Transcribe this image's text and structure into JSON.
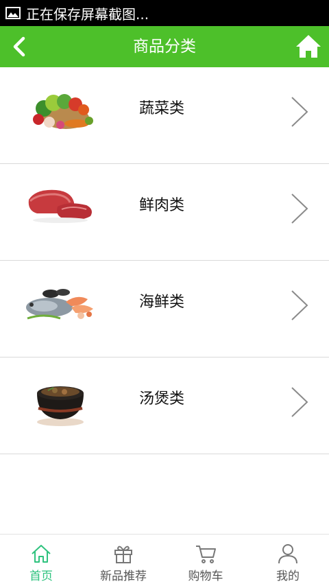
{
  "status_bar": {
    "notification_text": "正在保存屏幕截图..."
  },
  "nav": {
    "title": "商品分类"
  },
  "categories": [
    {
      "label": "蔬菜类"
    },
    {
      "label": "鲜肉类"
    },
    {
      "label": "海鲜类"
    },
    {
      "label": "汤煲类"
    }
  ],
  "tabs": [
    {
      "label": "首页",
      "icon": "home-icon",
      "active": true
    },
    {
      "label": "新品推荐",
      "icon": "gift-icon"
    },
    {
      "label": "购物车",
      "icon": "cart-icon"
    },
    {
      "label": "我的",
      "icon": "user-icon"
    }
  ],
  "colors": {
    "nav_bg": "#4dc02a",
    "tab_active": "#2ec27e"
  }
}
